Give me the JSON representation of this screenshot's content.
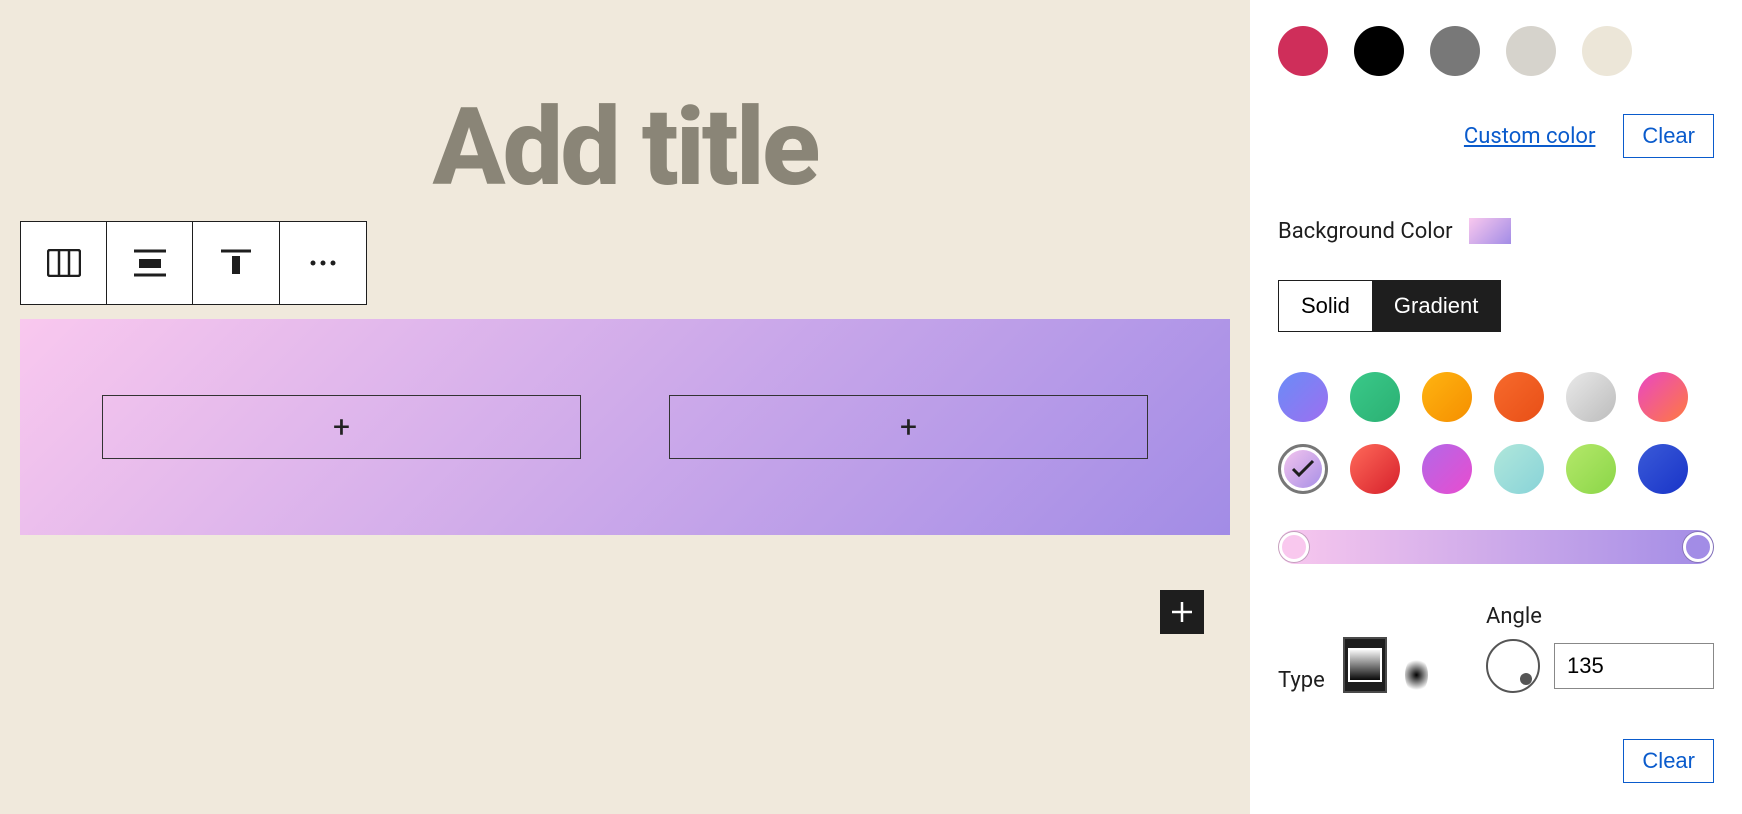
{
  "editor": {
    "title_placeholder": "Add title",
    "column_add": "+",
    "fab_add": "+"
  },
  "toolbar": {
    "tool_columns": "columns",
    "tool_align": "align",
    "tool_valign": "vertical-align",
    "tool_more": "more"
  },
  "sidebar": {
    "text_swatches": [
      {
        "name": "vivid-red",
        "color": "#cf2e5a"
      },
      {
        "name": "black",
        "color": "#000000"
      },
      {
        "name": "gray",
        "color": "#787878"
      },
      {
        "name": "light-gray",
        "color": "#d6d3cc"
      },
      {
        "name": "off-white",
        "color": "#ece6d8"
      }
    ],
    "custom_color_label": "Custom color",
    "clear_label": "Clear",
    "bg_label": "Background Color",
    "seg_solid": "Solid",
    "seg_gradient": "Gradient",
    "gradient_presets": [
      {
        "name": "blue-purple",
        "css": "linear-gradient(135deg,#6a8cf7,#9d6ff0)"
      },
      {
        "name": "green",
        "css": "linear-gradient(135deg,#3ac989,#2bb073)"
      },
      {
        "name": "orange",
        "css": "linear-gradient(135deg,#ffb411,#f58f00)"
      },
      {
        "name": "red-orange",
        "css": "linear-gradient(135deg,#f76a2c,#e84f17)"
      },
      {
        "name": "silver",
        "css": "linear-gradient(135deg,#e9e9e9,#bcbcbc)"
      },
      {
        "name": "magenta-orange",
        "css": "linear-gradient(135deg,#e947c4,#ff7a3f)"
      },
      {
        "name": "pink-purple-selected",
        "css": "linear-gradient(135deg,#f9c8ee,#a28ce6)",
        "selected": true
      },
      {
        "name": "red",
        "css": "linear-gradient(135deg,#ff6a5a,#d6202b)"
      },
      {
        "name": "violet-magenta",
        "css": "linear-gradient(135deg,#b268e8,#e94ccf)"
      },
      {
        "name": "teal-mint",
        "css": "linear-gradient(135deg,#b0e7db,#88d3d8)"
      },
      {
        "name": "lime",
        "css": "linear-gradient(135deg,#b4e86a,#8bd648)"
      },
      {
        "name": "blue",
        "css": "linear-gradient(135deg,#3a5ad8,#1934c8)"
      }
    ],
    "type_label": "Type",
    "angle_label": "Angle",
    "angle_value": "135"
  }
}
